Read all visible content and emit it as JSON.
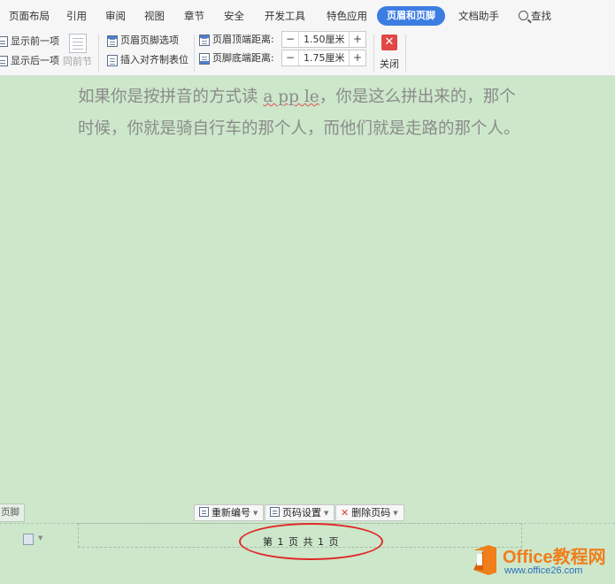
{
  "tabs": [
    {
      "label": "页面布局",
      "active": false
    },
    {
      "label": "引用",
      "active": false
    },
    {
      "label": "审阅",
      "active": false
    },
    {
      "label": "视图",
      "active": false
    },
    {
      "label": "章节",
      "active": false
    },
    {
      "label": "安全",
      "active": false
    },
    {
      "label": "开发工具",
      "active": false
    },
    {
      "label": "特色应用",
      "active": false
    },
    {
      "label": "页眉和页脚",
      "active": true
    },
    {
      "label": "文档助手",
      "active": false
    },
    {
      "label": "查找",
      "active": false,
      "icon": "search-icon"
    }
  ],
  "toolbar": {
    "show_prev": "显示前一项",
    "show_next": "显示后一项",
    "same_as_previous": "同前节",
    "header_footer_options": "页眉页脚选项",
    "insert_align_tab": "插入对齐制表位",
    "header_top_label": "页眉顶端距离:",
    "header_top_value": "1.50厘米",
    "footer_bottom_label": "页脚底端距离:",
    "footer_bottom_value": "1.75厘米",
    "minus": "−",
    "plus": "+",
    "close": "关闭"
  },
  "document": {
    "line1_pre": "如果你是按拼音的方式读 ",
    "line1_word": "a pp le",
    "line1_post": "，你是这么拼出来的，那个",
    "line2": "时候，你就是骑自行车的那个人，而他们就是走路的那个人。"
  },
  "footer": {
    "tag": "页脚",
    "renumber": "重新编号",
    "page_setup": "页码设置",
    "delete_page_num": "删除页码",
    "page_number_text": "第 1 页 共 1 页"
  },
  "watermark": {
    "title": "Office教程网",
    "url": "www.office26.com"
  },
  "colors": {
    "page_bg": "#cde7cb",
    "active_tab": "#3c7de2",
    "close_red": "#e04848",
    "ellipse_red": "#e02a2a",
    "logo_orange": "#f07e1a"
  }
}
